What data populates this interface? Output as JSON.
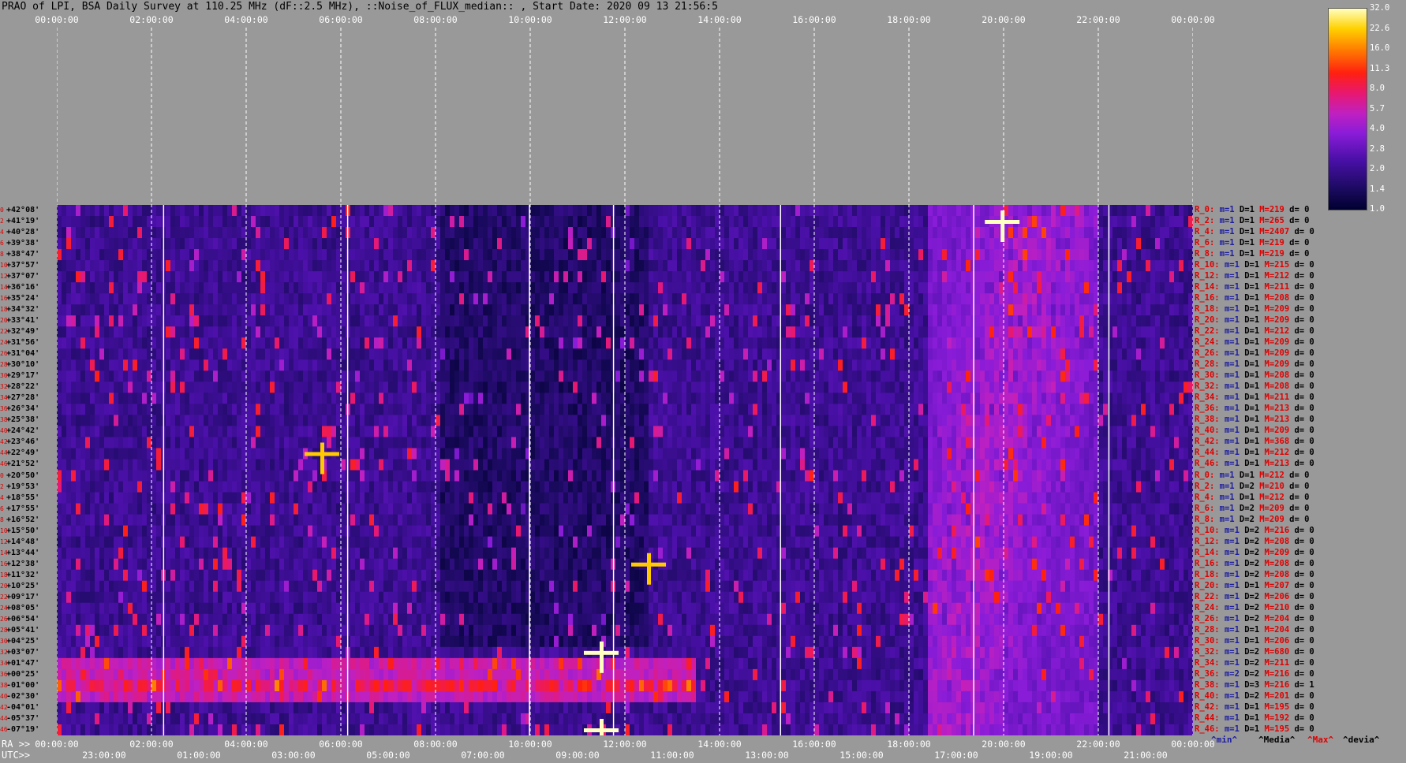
{
  "title": "PRAO of LPI, BSA Daily Survey at 110.25 MHz (dF::2.5 MHz), ::Noise_of_FLUX_median:: , Start Date: 2020 09 13 21:56:5",
  "chart_data": {
    "type": "heatmap",
    "title": "PRAO of LPI, BSA Daily Survey at 110.25 MHz (dF::2.5 MHz), ::Noise_of_FLUX_median:: , Start Date: 2020 09 13 21:56:5",
    "x_top_ticks": [
      "00:00:00",
      "02:00:00",
      "04:00:00",
      "06:00:00",
      "08:00:00",
      "10:00:00",
      "12:00:00",
      "14:00:00",
      "16:00:00",
      "18:00:00",
      "20:00:00",
      "22:00:00",
      "00:00:00"
    ],
    "ra_ticks": [
      "00:00:00",
      "02:00:00",
      "04:00:00",
      "06:00:00",
      "08:00:00",
      "10:00:00",
      "12:00:00",
      "14:00:00",
      "16:00:00",
      "18:00:00",
      "20:00:00",
      "22:00:00",
      "00:00:00"
    ],
    "utc_ticks": [
      "23:00:00",
      "01:00:00",
      "03:00:00",
      "05:00:00",
      "07:00:00",
      "09:00:00",
      "11:00:00",
      "13:00:00",
      "15:00:00",
      "17:00:00",
      "19:00:00",
      "21:00:00"
    ],
    "ra_label": "RA >>",
    "utc_label": "UTC>>",
    "declinations": [
      "+42°08'",
      "+41°19'",
      "+40°28'",
      "+39°38'",
      "+38°47'",
      "+37°57'",
      "+37°07'",
      "+36°16'",
      "+35°24'",
      "+34°32'",
      "+33°41'",
      "+32°49'",
      "+31°56'",
      "+31°04'",
      "+30°10'",
      "+29°17'",
      "+28°22'",
      "+27°28'",
      "+26°34'",
      "+25°38'",
      "+24°42'",
      "+23°46'",
      "+22°49'",
      "+21°52'",
      "+20°50'",
      "+19°53'",
      "+18°55'",
      "+17°55'",
      "+16°52'",
      "+15°50'",
      "+14°48'",
      "+13°44'",
      "+12°38'",
      "+11°32'",
      "+10°25'",
      "+09°17'",
      "+08°05'",
      "+06°54'",
      "+05°41'",
      "+04°25'",
      "+03°07'",
      "+01°47'",
      "+00°25'",
      "-01°00'",
      "-02°30'",
      "-04°01'",
      "-05°37'",
      "-07°19'"
    ],
    "row_indices": [
      "0",
      "2",
      "4",
      "6",
      "8",
      "10",
      "12",
      "14",
      "16",
      "18",
      "20",
      "22",
      "24",
      "26",
      "28",
      "30",
      "32",
      "34",
      "36",
      "38",
      "40",
      "42",
      "44",
      "46",
      "0",
      "2",
      "4",
      "6",
      "8",
      "10",
      "12",
      "14",
      "16",
      "18",
      "20",
      "22",
      "24",
      "26",
      "28",
      "30",
      "32",
      "34",
      "36",
      "38",
      "40",
      "42",
      "44",
      "46"
    ],
    "colorbar": {
      "labels": [
        "32.0",
        "22.6",
        "16.0",
        "11.3",
        "8.0",
        "5.7",
        "4.0",
        "2.8",
        "2.0",
        "1.4",
        "1.0"
      ],
      "range": [
        1.0,
        32.0
      ],
      "scale": "log"
    },
    "grid_vertical_dashed": true,
    "bright_sources": [
      {
        "ra_hours": 19.97,
        "row": 1,
        "value": 32
      },
      {
        "ra_hours": 11.5,
        "row": 40,
        "value": 32
      },
      {
        "ra_hours": 11.5,
        "row": 47,
        "value": 32
      },
      {
        "ra_hours": 5.6,
        "row": 22,
        "value": 22
      },
      {
        "ra_hours": 12.5,
        "row": 32,
        "value": 22
      }
    ]
  },
  "right_rows": [
    {
      "name": "R_0:",
      "m": "m=1",
      "d": "D=1",
      "max": "M=219",
      "dev": "d= 0"
    },
    {
      "name": "R_2:",
      "m": "m=1",
      "d": "D=1",
      "max": "M=265",
      "dev": "d= 0"
    },
    {
      "name": "R_4:",
      "m": "m=1",
      "d": "D=1",
      "max": "M=2407",
      "dev": "d= 0"
    },
    {
      "name": "R_6:",
      "m": "m=1",
      "d": "D=1",
      "max": "M=219",
      "dev": "d= 0"
    },
    {
      "name": "R_8:",
      "m": "m=1",
      "d": "D=1",
      "max": "M=219",
      "dev": "d= 0"
    },
    {
      "name": "R_10:",
      "m": "m=1",
      "d": "D=1",
      "max": "M=215",
      "dev": "d= 0"
    },
    {
      "name": "R_12:",
      "m": "m=1",
      "d": "D=1",
      "max": "M=212",
      "dev": "d= 0"
    },
    {
      "name": "R_14:",
      "m": "m=1",
      "d": "D=1",
      "max": "M=211",
      "dev": "d= 0"
    },
    {
      "name": "R_16:",
      "m": "m=1",
      "d": "D=1",
      "max": "M=208",
      "dev": "d= 0"
    },
    {
      "name": "R_18:",
      "m": "m=1",
      "d": "D=1",
      "max": "M=209",
      "dev": "d= 0"
    },
    {
      "name": "R_20:",
      "m": "m=1",
      "d": "D=1",
      "max": "M=209",
      "dev": "d= 0"
    },
    {
      "name": "R_22:",
      "m": "m=1",
      "d": "D=1",
      "max": "M=212",
      "dev": "d= 0"
    },
    {
      "name": "R_24:",
      "m": "m=1",
      "d": "D=1",
      "max": "M=209",
      "dev": "d= 0"
    },
    {
      "name": "R_26:",
      "m": "m=1",
      "d": "D=1",
      "max": "M=209",
      "dev": "d= 0"
    },
    {
      "name": "R_28:",
      "m": "m=1",
      "d": "D=1",
      "max": "M=209",
      "dev": "d= 0"
    },
    {
      "name": "R_30:",
      "m": "m=1",
      "d": "D=1",
      "max": "M=208",
      "dev": "d= 0"
    },
    {
      "name": "R_32:",
      "m": "m=1",
      "d": "D=1",
      "max": "M=208",
      "dev": "d= 0"
    },
    {
      "name": "R_34:",
      "m": "m=1",
      "d": "D=1",
      "max": "M=211",
      "dev": "d= 0"
    },
    {
      "name": "R_36:",
      "m": "m=1",
      "d": "D=1",
      "max": "M=213",
      "dev": "d= 0"
    },
    {
      "name": "R_38:",
      "m": "m=1",
      "d": "D=1",
      "max": "M=213",
      "dev": "d= 0"
    },
    {
      "name": "R_40:",
      "m": "m=1",
      "d": "D=1",
      "max": "M=209",
      "dev": "d= 0"
    },
    {
      "name": "R_42:",
      "m": "m=1",
      "d": "D=1",
      "max": "M=368",
      "dev": "d= 0"
    },
    {
      "name": "R_44:",
      "m": "m=1",
      "d": "D=1",
      "max": "M=212",
      "dev": "d= 0"
    },
    {
      "name": "R_46:",
      "m": "m=1",
      "d": "D=1",
      "max": "M=213",
      "dev": "d= 0"
    },
    {
      "name": "R_0:",
      "m": "m=1",
      "d": "D=1",
      "max": "M=212",
      "dev": "d= 0"
    },
    {
      "name": "R_2:",
      "m": "m=1",
      "d": "D=2",
      "max": "M=210",
      "dev": "d= 0"
    },
    {
      "name": "R_4:",
      "m": "m=1",
      "d": "D=1",
      "max": "M=212",
      "dev": "d= 0"
    },
    {
      "name": "R_6:",
      "m": "m=1",
      "d": "D=2",
      "max": "M=209",
      "dev": "d= 0"
    },
    {
      "name": "R_8:",
      "m": "m=1",
      "d": "D=2",
      "max": "M=209",
      "dev": "d= 0"
    },
    {
      "name": "R_10:",
      "m": "m=1",
      "d": "D=2",
      "max": "M=216",
      "dev": "d= 0"
    },
    {
      "name": "R_12:",
      "m": "m=1",
      "d": "D=2",
      "max": "M=208",
      "dev": "d= 0"
    },
    {
      "name": "R_14:",
      "m": "m=1",
      "d": "D=2",
      "max": "M=209",
      "dev": "d= 0"
    },
    {
      "name": "R_16:",
      "m": "m=1",
      "d": "D=2",
      "max": "M=208",
      "dev": "d= 0"
    },
    {
      "name": "R_18:",
      "m": "m=1",
      "d": "D=2",
      "max": "M=208",
      "dev": "d= 0"
    },
    {
      "name": "R_20:",
      "m": "m=1",
      "d": "D=1",
      "max": "M=207",
      "dev": "d= 0"
    },
    {
      "name": "R_22:",
      "m": "m=1",
      "d": "D=2",
      "max": "M=206",
      "dev": "d= 0"
    },
    {
      "name": "R_24:",
      "m": "m=1",
      "d": "D=2",
      "max": "M=210",
      "dev": "d= 0"
    },
    {
      "name": "R_26:",
      "m": "m=1",
      "d": "D=2",
      "max": "M=204",
      "dev": "d= 0"
    },
    {
      "name": "R_28:",
      "m": "m=1",
      "d": "D=1",
      "max": "M=204",
      "dev": "d= 0"
    },
    {
      "name": "R_30:",
      "m": "m=1",
      "d": "D=1",
      "max": "M=206",
      "dev": "d= 0"
    },
    {
      "name": "R_32:",
      "m": "m=1",
      "d": "D=2",
      "max": "M=680",
      "dev": "d= 0"
    },
    {
      "name": "R_34:",
      "m": "m=1",
      "d": "D=2",
      "max": "M=211",
      "dev": "d= 0"
    },
    {
      "name": "R_36:",
      "m": "m=2",
      "d": "D=2",
      "max": "M=216",
      "dev": "d= 0"
    },
    {
      "name": "R_38:",
      "m": "m=1",
      "d": "D=3",
      "max": "M=216",
      "dev": "d= 1"
    },
    {
      "name": "R_40:",
      "m": "m=1",
      "d": "D=2",
      "max": "M=201",
      "dev": "d= 0"
    },
    {
      "name": "R_42:",
      "m": "m=1",
      "d": "D=1",
      "max": "M=195",
      "dev": "d= 0"
    },
    {
      "name": "R_44:",
      "m": "m=1",
      "d": "D=1",
      "max": "M=192",
      "dev": "d= 0"
    },
    {
      "name": "R_46:",
      "m": "m=1",
      "d": "D=1",
      "max": "M=195",
      "dev": "d= 0"
    }
  ],
  "legend": {
    "min": "^min^",
    "media": "^Media^",
    "max": "^Max^",
    "devia": "^devia^"
  },
  "colors": {
    "background": "#999999",
    "grid": "#ffffff",
    "label_red": "#e00000",
    "label_blue": "#1c1ca0"
  }
}
